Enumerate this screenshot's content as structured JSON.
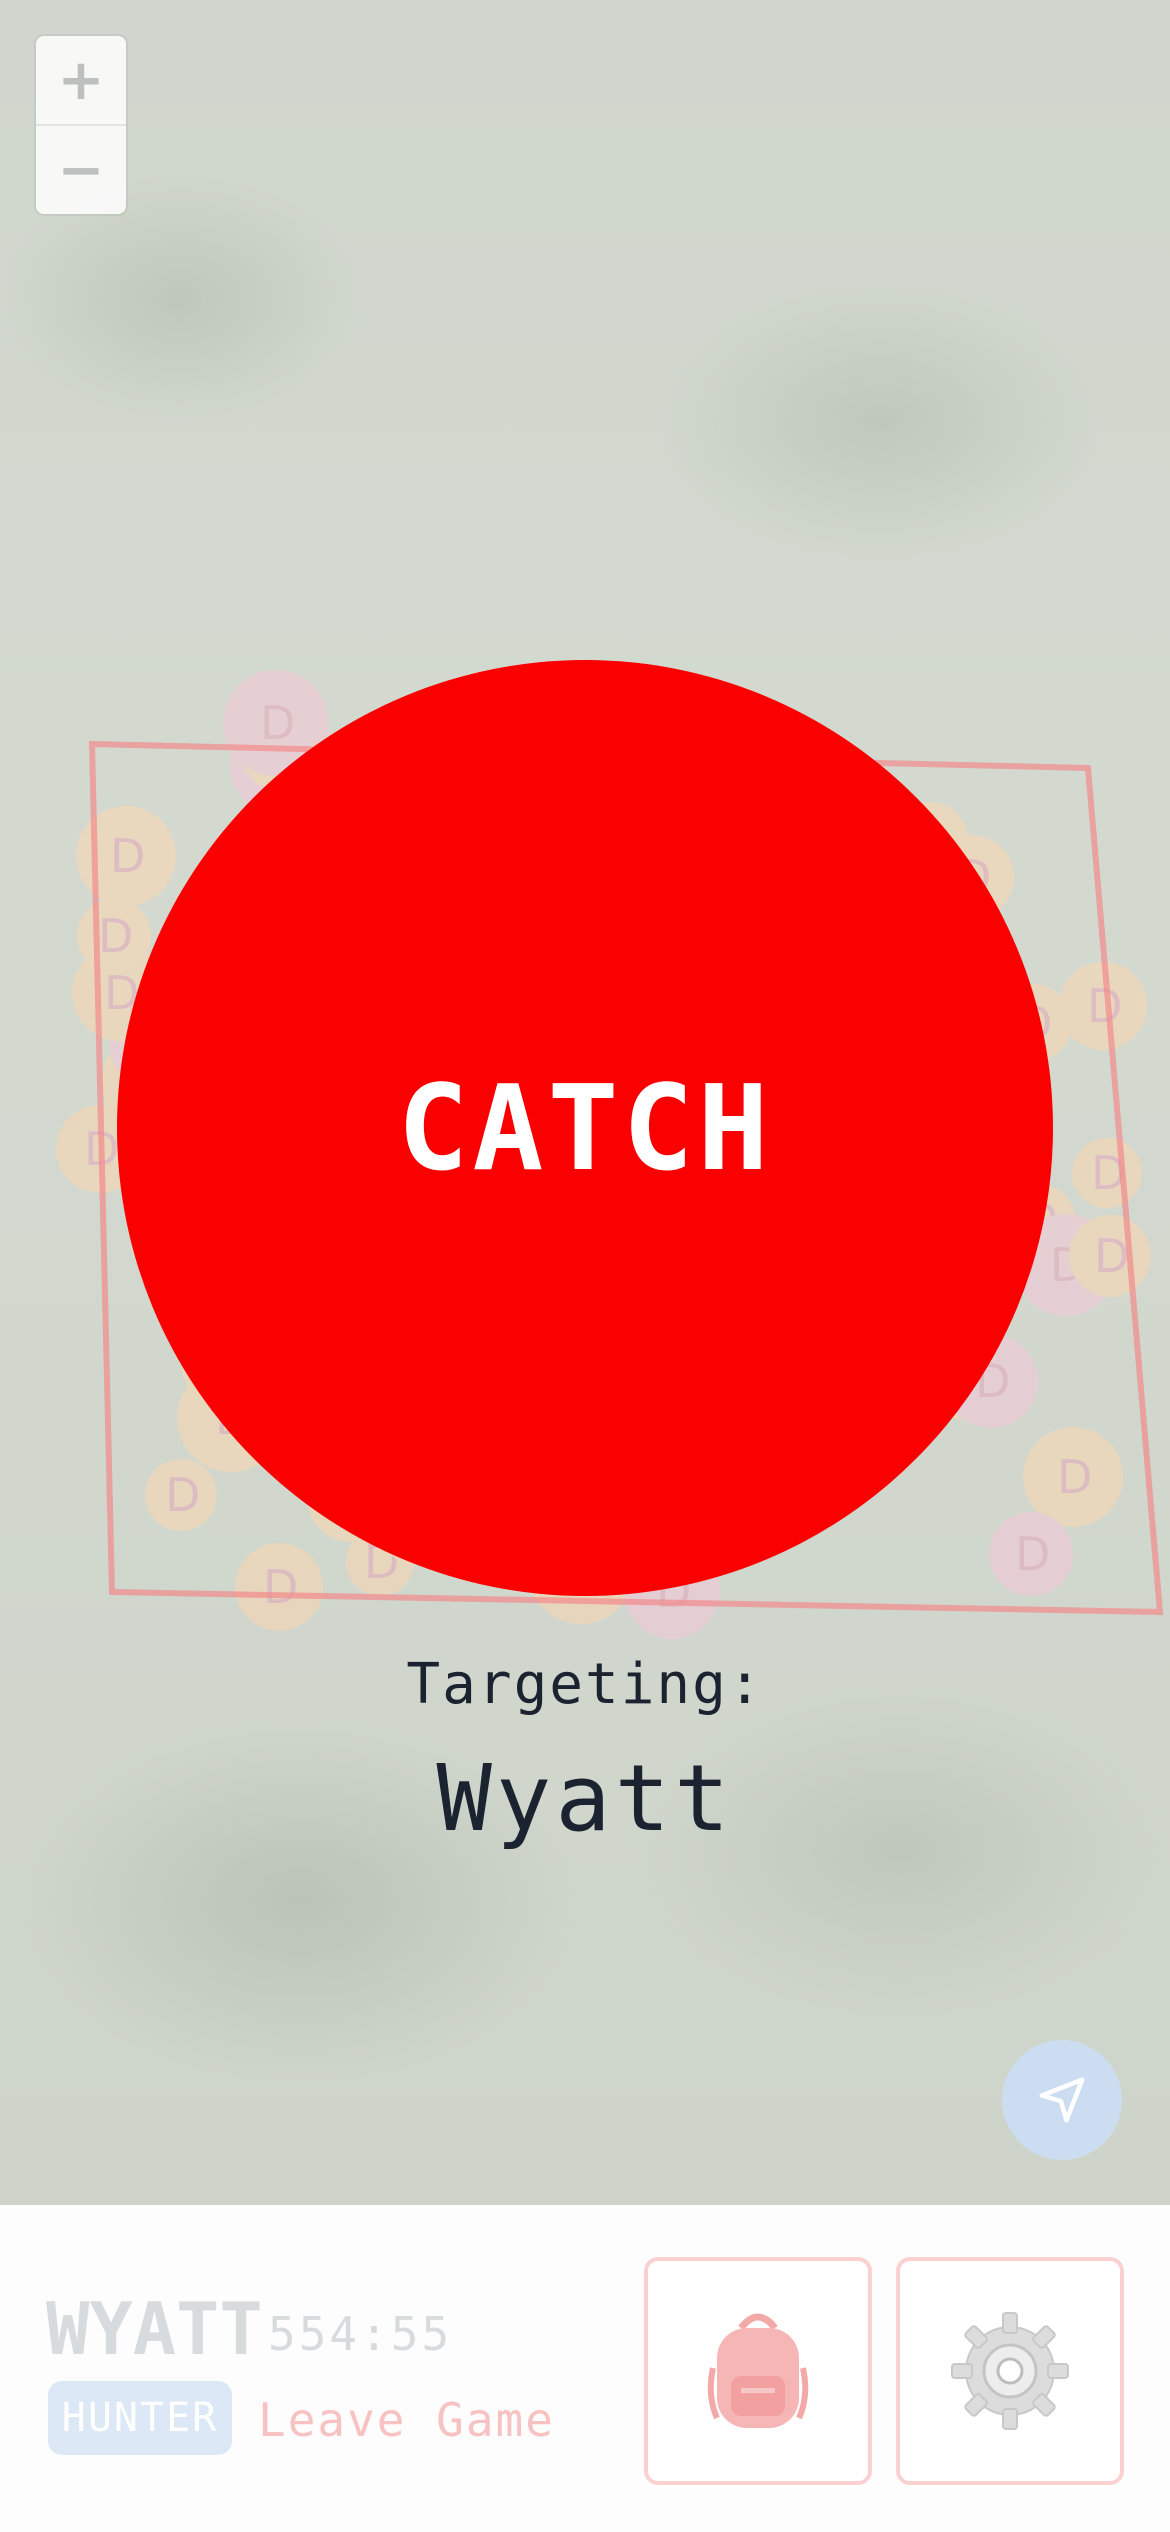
{
  "map": {
    "zoom_in_label": "+",
    "zoom_out_label": "−",
    "zone_marker_letter": "D",
    "locate_icon": "navigation-arrow-icon"
  },
  "catch_button": {
    "label": "CATCH",
    "color": "#fa0000"
  },
  "target": {
    "heading": "Targeting:",
    "name": "Wyatt"
  },
  "player": {
    "name": "WYATT",
    "timer": "554:55",
    "role": "HUNTER",
    "leave_label": "Leave Game"
  },
  "actions": {
    "inventory_icon": "backpack-icon",
    "settings_icon": "gear-icon"
  },
  "colors": {
    "accent_red": "#fa0000",
    "zone_outline": "#f28a8a",
    "zone_fill_orange": "#fbd6b0",
    "zone_fill_pink": "#f6c8d8",
    "role_badge": "#dde8f6"
  }
}
